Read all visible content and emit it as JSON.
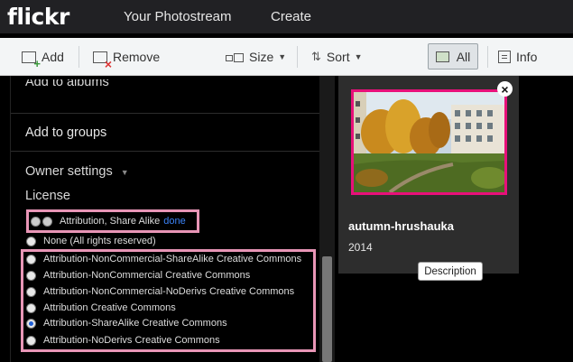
{
  "topnav": {
    "logo": "flickr",
    "photostream": "Your Photostream",
    "create": "Create"
  },
  "toolbar": {
    "add": "Add",
    "remove": "Remove",
    "size": "Size",
    "sort": "Sort",
    "all": "All",
    "info": "Info"
  },
  "panel": {
    "add_to_albums": "Add to albums",
    "add_to_groups": "Add to groups",
    "owner_settings": "Owner settings",
    "license_heading": "License",
    "current_license": "Attribution, Share Alike",
    "done": "done",
    "license_options": [
      {
        "label": "None (All rights reserved)",
        "selected": false
      },
      {
        "label": "Attribution-NonCommercial-ShareAlike Creative Commons",
        "selected": false
      },
      {
        "label": "Attribution-NonCommercial Creative Commons",
        "selected": false
      },
      {
        "label": "Attribution-NonCommercial-NoDerivs Creative Commons",
        "selected": false
      },
      {
        "label": "Attribution Creative Commons",
        "selected": false
      },
      {
        "label": "Attribution-ShareAlike Creative Commons",
        "selected": true
      },
      {
        "label": "Attribution-NoDerivs Creative Commons",
        "selected": false
      }
    ]
  },
  "photo": {
    "title": "autumn-hrushauka",
    "year": "2014",
    "tooltip": "Description"
  },
  "colors": {
    "highlight": "#e895b6",
    "thumb_border": "#e8107a",
    "link": "#3b82f6"
  }
}
